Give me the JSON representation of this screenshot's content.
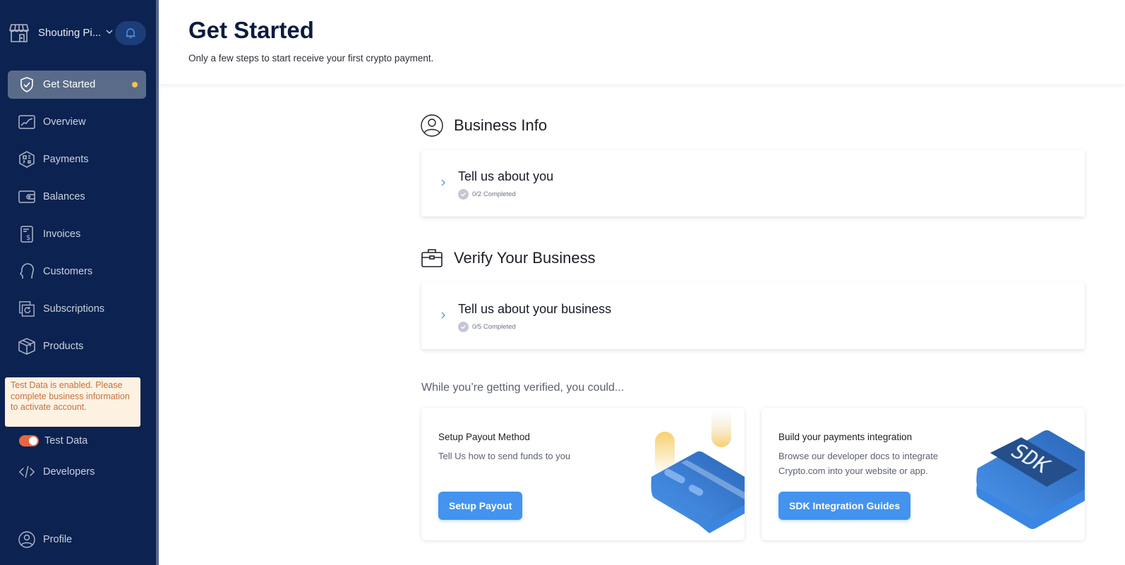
{
  "sidebar": {
    "store_name": "Shouting Pi...",
    "items": [
      {
        "label": "Get Started",
        "icon": "shield-check-icon",
        "active": true,
        "has_dot": true
      },
      {
        "label": "Overview",
        "icon": "chart-line-icon"
      },
      {
        "label": "Payments",
        "icon": "qr-code-icon"
      },
      {
        "label": "Balances",
        "icon": "wallet-icon"
      },
      {
        "label": "Invoices",
        "icon": "invoice-icon"
      },
      {
        "label": "Customers",
        "icon": "customer-head-icon"
      },
      {
        "label": "Subscriptions",
        "icon": "subscription-icon"
      },
      {
        "label": "Products",
        "icon": "box-icon"
      }
    ],
    "test_banner": "Test Data is enabled. Please complete business information to activate account.",
    "test_toggle": {
      "label": "Test Data",
      "on": true
    },
    "developers": "Developers",
    "profile": "Profile"
  },
  "header": {
    "title": "Get Started",
    "subtitle": "Only a few steps to start receive your first crypto payment."
  },
  "sections": [
    {
      "title": "Business Info",
      "icon": "user-circle-icon",
      "step": {
        "title": "Tell us about you",
        "progress": "0/2 Completed"
      }
    },
    {
      "title": "Verify Your Business",
      "icon": "briefcase-icon",
      "step": {
        "title": "Tell us about your business",
        "progress": "0/5 Completed"
      }
    }
  ],
  "while_text": "While you’re getting verified, you could...",
  "actions": [
    {
      "title": "Setup Payout Method",
      "desc": "Tell Us how to send funds to you",
      "button": "Setup Payout",
      "illustration": "credit-card-illustration"
    },
    {
      "title": "Build your payments integration",
      "desc": "Browse our developer docs to integrate Crypto.com into your website or app.",
      "button": "SDK Integration Guides",
      "illustration": "sdk-illustration",
      "illustration_text": "SDK"
    }
  ],
  "colors": {
    "sidebar_bg": "#0c2250",
    "active_item_bg": "#5a6b8a",
    "accent_blue": "#4393ef",
    "dot_yellow": "#f4c34a",
    "toggle_orange": "#e7673f",
    "banner_bg": "#fdf2e2",
    "banner_text": "#c6703e"
  }
}
